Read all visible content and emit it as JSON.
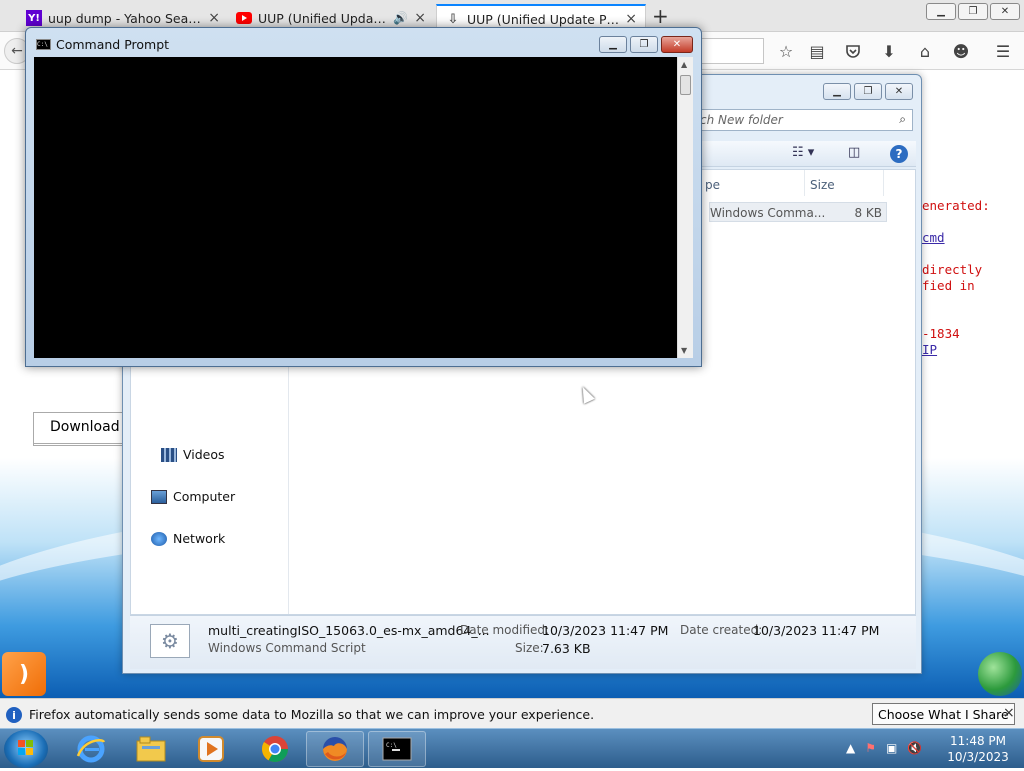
{
  "browser": {
    "tabs": [
      {
        "title": "uup dump - Yahoo Search ...",
        "icon": "yahoo-icon",
        "color": "#6001d2"
      },
      {
        "title": "UUP (Unified Update Pl...",
        "icon": "youtube-icon",
        "color": "#ff0000"
      },
      {
        "title": "UUP (Unified Update Platfo...",
        "icon": "page-icon",
        "color": "#555555"
      }
    ],
    "new_tab": "+",
    "page": {
      "code_lines": [
        {
          "text": "enerated:",
          "style": "code"
        },
        {
          "text": "cmd",
          "style": "link"
        },
        {
          "text": "directly",
          "style": "code"
        },
        {
          "text": "fied in",
          "style": "code"
        },
        {
          "text": "-1834",
          "style": "code"
        },
        {
          "text": "IP",
          "style": "link"
        }
      ],
      "download_button": "Download IS"
    },
    "notification": {
      "message": "Firefox automatically sends some data to Mozilla so that we can improve your experience.",
      "share_button": "Choose What I Share",
      "close": "×"
    }
  },
  "cmd": {
    "title": "Command Prompt",
    "icon_text": "C:\\"
  },
  "explorer": {
    "search_placeholder": "ch New folder",
    "columns": [
      "pe",
      "Size"
    ],
    "selected_row": {
      "type": "Windows Comma...",
      "size": "8 KB"
    },
    "nav": [
      "Videos",
      "Computer",
      "Network"
    ],
    "details": {
      "filename": "multi_creatingISO_15063.0_es-mx_amd64_...",
      "filetype": "Windows Command Script",
      "date_modified_label": "Date modified:",
      "date_modified": "10/3/2023 11:47 PM",
      "size_label": "Size:",
      "size": "7.63 KB",
      "date_created_label": "Date created:",
      "date_created": "10/3/2023 11:47 PM"
    }
  },
  "taskbar": {
    "time": "11:48 PM",
    "date": "10/3/2023",
    "tray_arrow": "▲"
  }
}
